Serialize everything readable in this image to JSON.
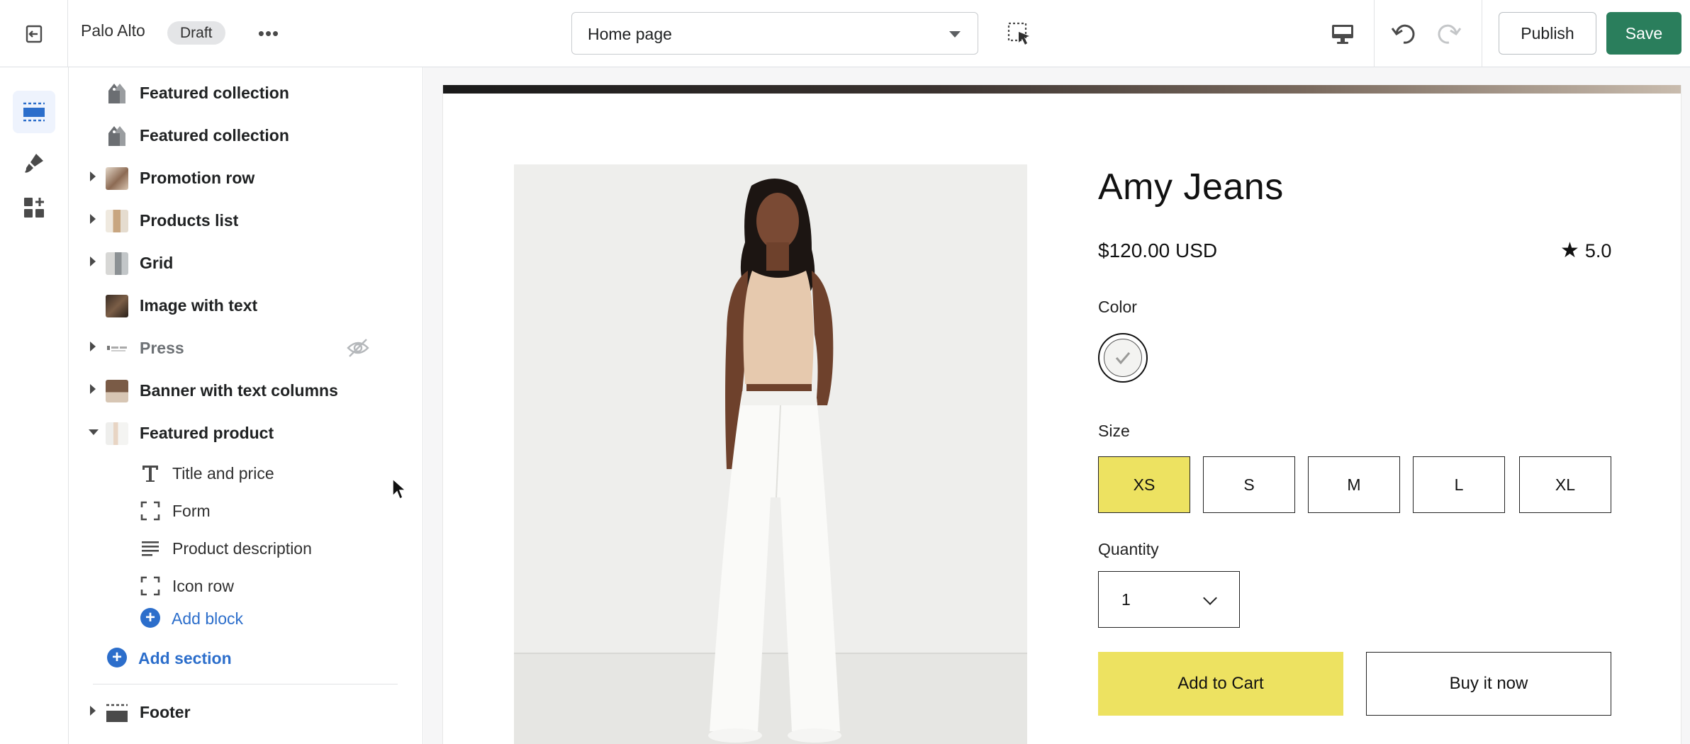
{
  "topbar": {
    "store_name": "Palo Alto",
    "status_badge": "Draft",
    "more_label": "•••",
    "page_select": "Home page",
    "publish_label": "Publish",
    "save_label": "Save"
  },
  "rail": {
    "items": [
      {
        "name": "sections",
        "icon": "sections-icon",
        "active": true
      },
      {
        "name": "theme-settings",
        "icon": "paintbrush-icon",
        "active": false
      },
      {
        "name": "apps",
        "icon": "apps-icon",
        "active": false
      }
    ]
  },
  "sidebar": {
    "sections": [
      {
        "label": "Featured collection",
        "expandable": false,
        "thumb": "tag-icon"
      },
      {
        "label": "Featured collection",
        "expandable": false,
        "thumb": "tag-icon"
      },
      {
        "label": "Promotion row",
        "expandable": true,
        "thumb": "image"
      },
      {
        "label": "Products list",
        "expandable": true,
        "thumb": "image"
      },
      {
        "label": "Grid",
        "expandable": true,
        "thumb": "image"
      },
      {
        "label": "Image with text",
        "expandable": false,
        "thumb": "image"
      },
      {
        "label": "Press",
        "expandable": true,
        "thumb": "image",
        "hidden": true
      },
      {
        "label": "Banner with text columns",
        "expandable": true,
        "thumb": "image"
      },
      {
        "label": "Featured product",
        "expandable": true,
        "expanded": true,
        "thumb": "image"
      }
    ],
    "blocks": [
      {
        "label": "Title and price",
        "icon": "text-icon"
      },
      {
        "label": "Form",
        "icon": "frame-icon"
      },
      {
        "label": "Product description",
        "icon": "paragraph-icon"
      },
      {
        "label": "Icon row",
        "icon": "frame-icon"
      }
    ],
    "add_block": "Add block",
    "add_section": "Add section",
    "footer": "Footer"
  },
  "product": {
    "title": "Amy Jeans",
    "price": "$120.00 USD",
    "rating_star": "★",
    "rating": "5.0",
    "color_label": "Color",
    "size_label": "Size",
    "sizes": [
      "XS",
      "S",
      "M",
      "L",
      "XL"
    ],
    "selected_size": "XS",
    "quantity_label": "Quantity",
    "quantity": "1",
    "add_to_cart": "Add to Cart",
    "buy_now": "Buy it now"
  },
  "colors": {
    "save_green": "#2a7e5c",
    "accent_blue": "#2c6ecb",
    "yellow": "#ede261"
  }
}
